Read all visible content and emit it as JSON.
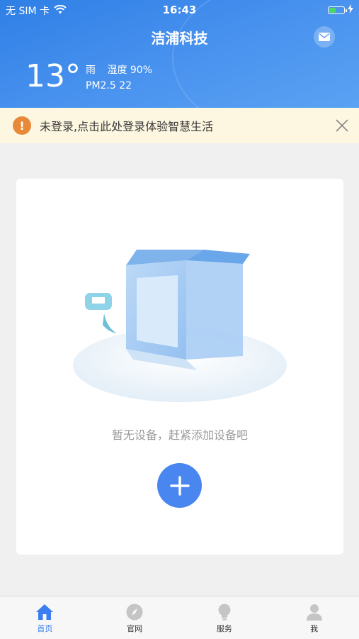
{
  "status_bar": {
    "carrier": "无 SIM 卡",
    "time": "16:43",
    "battery_level": 0.35
  },
  "header": {
    "title": "洁浦科技",
    "temperature": "13°",
    "weather": "雨",
    "humidity": "湿度 90%",
    "pm25": "PM2.5 22"
  },
  "notice": {
    "text": "未登录,点击此处登录体验智慧生活"
  },
  "empty_state": {
    "message": "暂无设备，赶紧添加设备吧"
  },
  "tabs": [
    {
      "label": "首页",
      "icon": "home-icon",
      "active": true
    },
    {
      "label": "官网",
      "icon": "compass-icon",
      "active": false
    },
    {
      "label": "服务",
      "icon": "lightbulb-icon",
      "active": false
    },
    {
      "label": "我",
      "icon": "person-icon",
      "active": false
    }
  ],
  "colors": {
    "header_blue": "#3b86ea",
    "accent": "#4a86f0",
    "warning": "#e8893a",
    "notice_bg": "#fdf6e0"
  }
}
